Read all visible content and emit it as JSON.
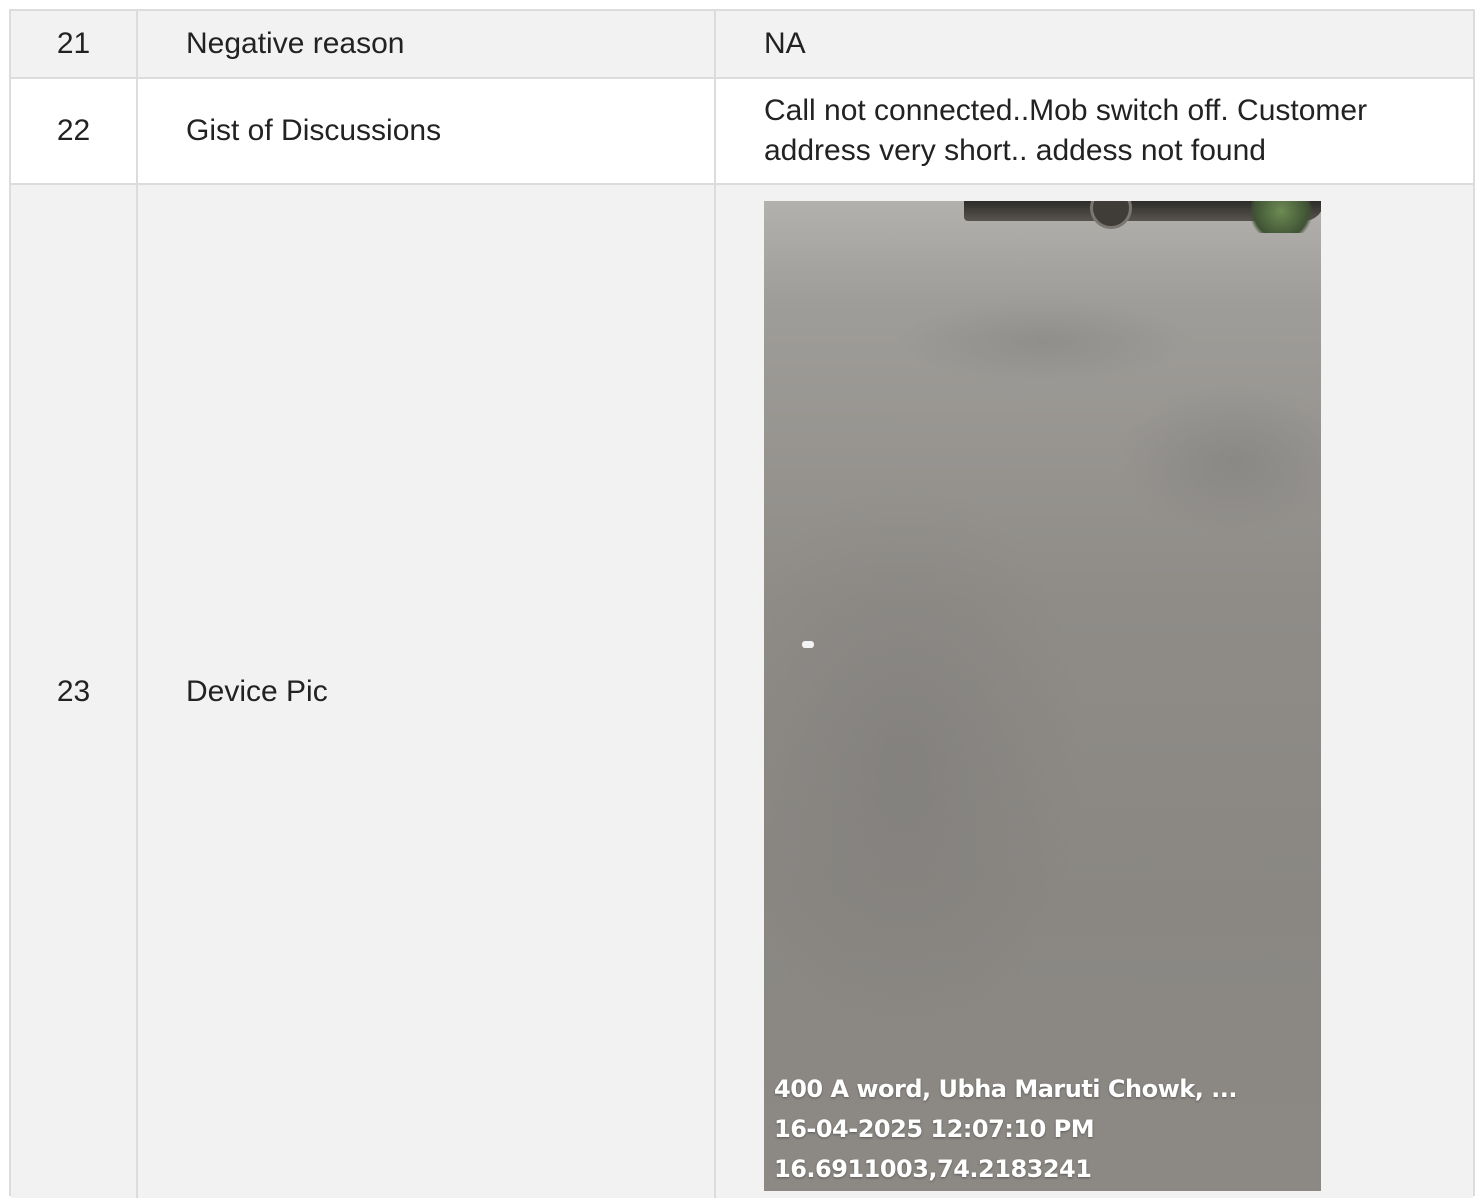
{
  "rows": [
    {
      "num": "21",
      "label": "Negative reason",
      "value": "NA"
    },
    {
      "num": "22",
      "label": "Gist of Discussions",
      "value": "Call not connected..Mob switch off. Customer address very short.. addess not found"
    },
    {
      "num": "23",
      "label": "Device Pic"
    }
  ],
  "photo": {
    "caption_address": "400 A word, Ubha Maruti Chowk, ...",
    "caption_datetime": "16-04-2025 12:07:10 PM",
    "caption_coords": "16.6911003,74.2183241"
  }
}
